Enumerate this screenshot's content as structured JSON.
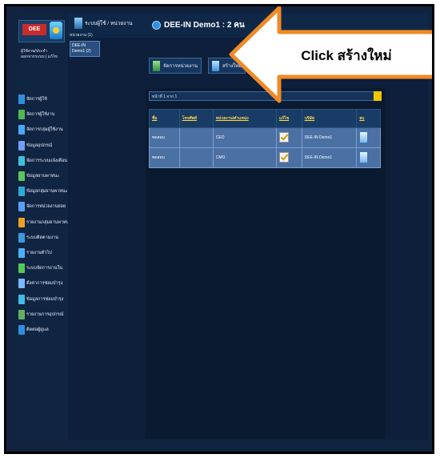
{
  "callout": {
    "text": "Click สร้างใหม่"
  },
  "header": {
    "breadcrumb": "ระบบผู้ใช้ / หน่วยงาน",
    "demo_title": "DEE-IN Demo1 : 2 คน"
  },
  "user": {
    "line1": "ผู้ใช้งาน/ประจำ",
    "line2": "ออกจากระบบ | แก้ไข"
  },
  "subnav": {
    "label": "หน่วยงาน (1)",
    "selected": "DEE-IN Demo1 (2)"
  },
  "toolbar": {
    "button1": "จัดการหน่วยงาน",
    "button2": "สร้างใหม่"
  },
  "pager": {
    "text": "หน้าที่ 1 จาก 1"
  },
  "table": {
    "columns": [
      "ชื่อ",
      "โทรศัพท์",
      "หน่วยงาน/ตำแหน่ง",
      "แก้ไข",
      "บริษัท",
      "ลบ"
    ],
    "rows": [
      {
        "name": "ทดสอบ",
        "phone": "",
        "unit": "CEO",
        "company": "DEE-IN Demo1"
      },
      {
        "name": "ทดสอบ",
        "phone": "",
        "unit": "CMO",
        "company": "DEE-IN Demo1"
      }
    ]
  },
  "sidebar": {
    "items": [
      {
        "label": "จัดการผู้ใช้",
        "color": "#2f8fe0"
      },
      {
        "label": "จัดการผู้ใช้งาน",
        "color": "#4fb84f"
      },
      {
        "label": "จัดการกลุ่มผู้ใช้งาน",
        "color": "#49a8ff"
      },
      {
        "label": "ข้อมูลอุปกรณ์",
        "color": "#6fa0ff"
      },
      {
        "label": "จัดการระบบแจ้งเตือน",
        "color": "#3fc0e0"
      },
      {
        "label": "ข้อมูลยานพาหนะ",
        "color": "#5cc85c"
      },
      {
        "label": "ข้อมูลกลุ่มยานพาหนะ",
        "color": "#2fa9d8"
      },
      {
        "label": "จัดการหน่วยงานย่อย",
        "color": "#58a0ff"
      },
      {
        "label": "รายงานกลุ่มยานพาหนะ",
        "color": "#f0a020"
      },
      {
        "label": "ระบบติดตามงาน",
        "color": "#3a9be0"
      },
      {
        "label": "รายงานทั่วไป",
        "color": "#4db0ff"
      },
      {
        "label": "ระบบจัดการงานใน",
        "color": "#55c855"
      },
      {
        "label": "ตั้งค่าการซ่อมบำรุง",
        "color": "#7ab8ff"
      },
      {
        "label": "ข้อมูลการซ่อมบำรุง",
        "color": "#3dbde8"
      },
      {
        "label": "รายงานการอุปกรณ์",
        "color": "#60b060"
      },
      {
        "label": "ติดต่อผู้ดูแล",
        "color": "#2f8fe0"
      }
    ]
  }
}
